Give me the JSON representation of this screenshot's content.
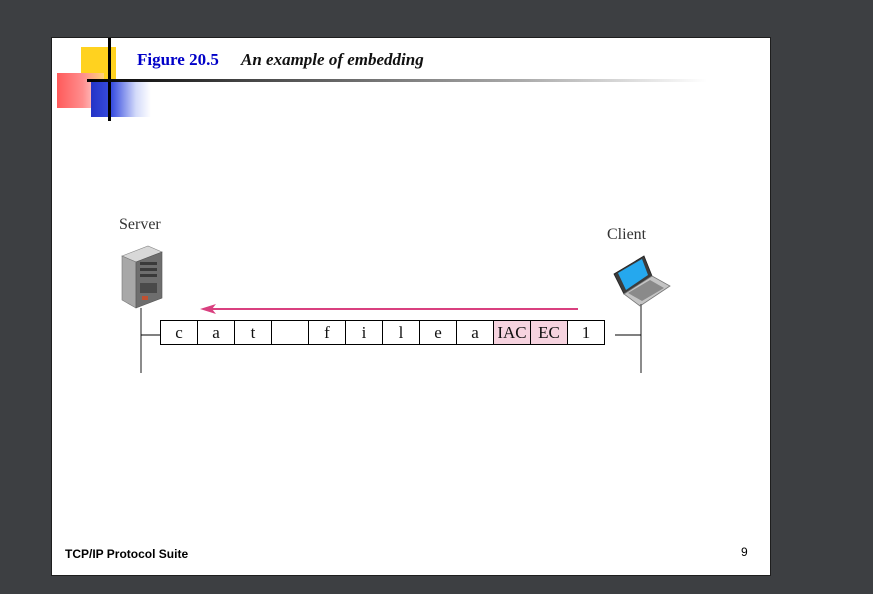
{
  "slide": {
    "figure_label": "Figure 20.5",
    "figure_title": "An example of embedding",
    "footer": "TCP/IP Protocol Suite",
    "page_number": "9"
  },
  "diagram": {
    "server_label": "Server",
    "client_label": "Client",
    "cells": [
      {
        "text": "c",
        "highlight": false
      },
      {
        "text": "a",
        "highlight": false
      },
      {
        "text": "t",
        "highlight": false
      },
      {
        "text": "",
        "highlight": false
      },
      {
        "text": "f",
        "highlight": false
      },
      {
        "text": "i",
        "highlight": false
      },
      {
        "text": "l",
        "highlight": false
      },
      {
        "text": "e",
        "highlight": false
      },
      {
        "text": "a",
        "highlight": false
      },
      {
        "text": "IAC",
        "highlight": true
      },
      {
        "text": "EC",
        "highlight": true
      },
      {
        "text": "1",
        "highlight": false
      }
    ],
    "colors": {
      "arrow": "#d9407f",
      "highlight": "#f6d3df",
      "screen": "#25a8ee",
      "title_blue": "#0000c8"
    }
  }
}
